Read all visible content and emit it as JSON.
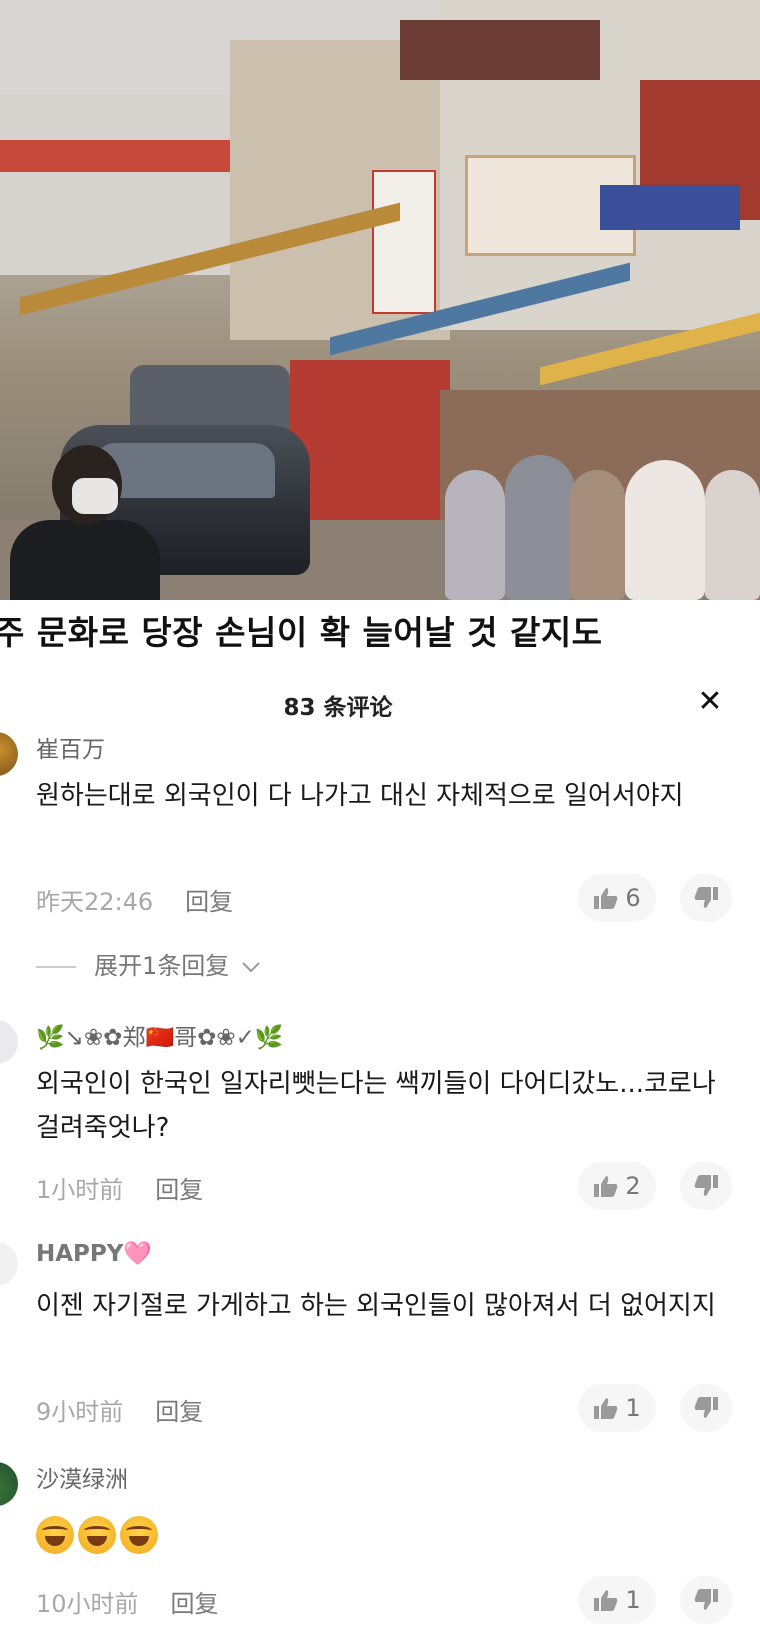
{
  "video": {
    "subtitle": "주 문화로 당장 손님이 확 늘어날 것 같지도"
  },
  "header": {
    "comment_count": "83 条评论",
    "close_label": "✕"
  },
  "comments": [
    {
      "username": "崔百万",
      "text": "원하는대로 외국인이 다 나가고 대신 자체적으로 일어서야지",
      "time": "昨天22:46",
      "reply": "回复",
      "likes": "6",
      "expand": "展开1条回复"
    },
    {
      "username": "🌿↘❀✿郑🇨🇳哥✿❀✓🌿",
      "text": "외국인이  한국인  일자리뺏는다는 쌕끼들이 다어디갔노...코로나걸려죽엇나?",
      "time": "1小时前",
      "reply": "回复",
      "likes": "2"
    },
    {
      "username": "HAPPY🩷",
      "text": "이젠  자기절로 가게하고 하는 외국인들이 많아져서  더 없어지지",
      "time": "9小时前",
      "reply": "回复",
      "likes": "1"
    },
    {
      "username": "沙漠绿洲",
      "text": "",
      "time": "10小时前",
      "reply": "回复",
      "likes": "1"
    }
  ],
  "colors": {
    "meta_gray": "#a8a8a8",
    "pill_bg": "#f6f6f6"
  }
}
